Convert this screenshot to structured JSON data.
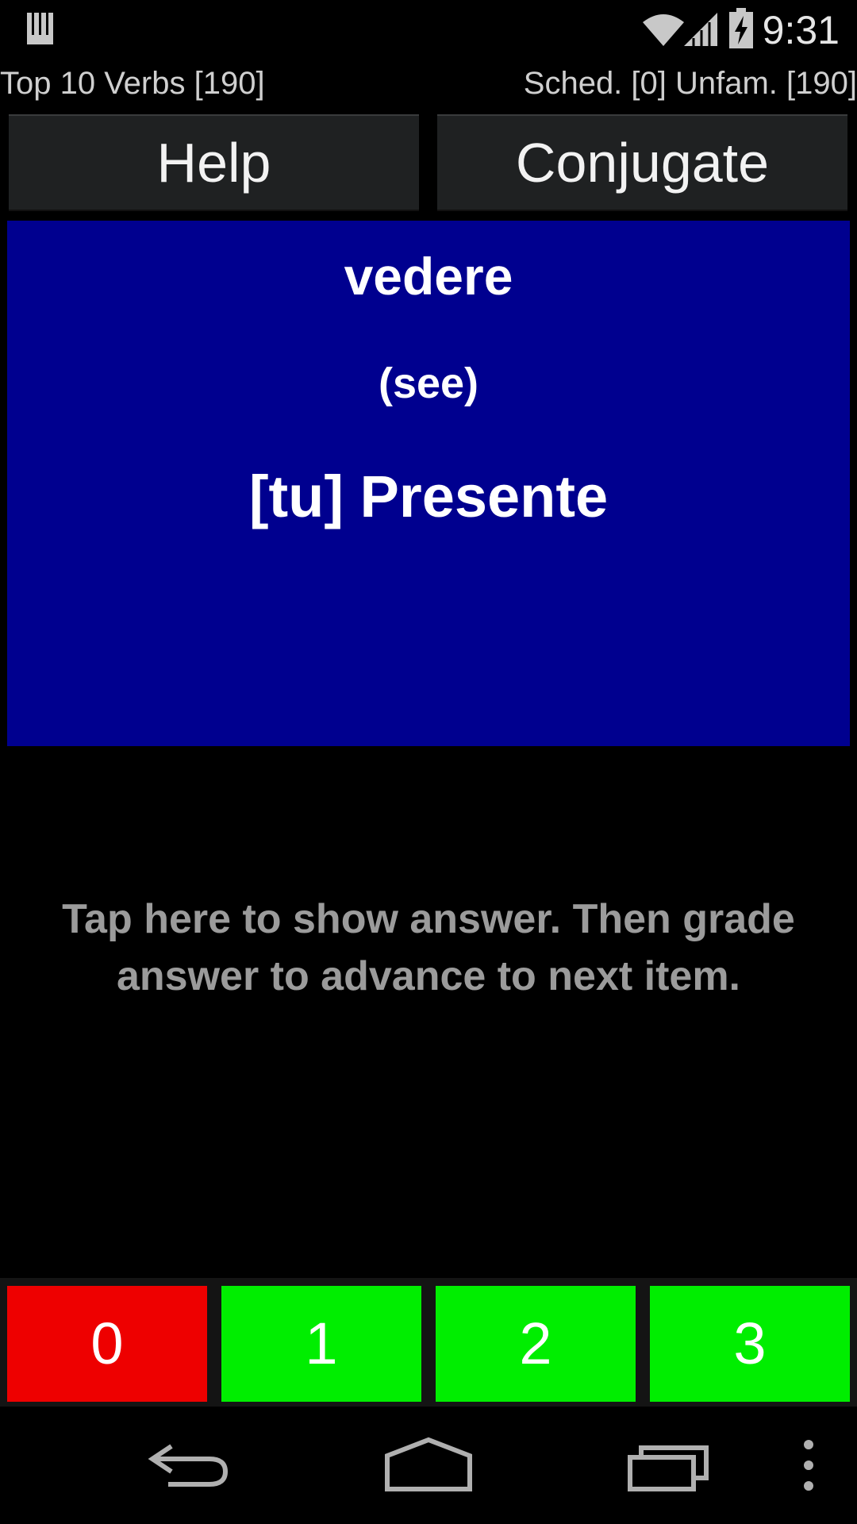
{
  "status_bar": {
    "time": "9:31",
    "icons": [
      "notification-icon",
      "wifi-icon",
      "signal-icon",
      "battery-charging-icon"
    ]
  },
  "info": {
    "deck": "Top 10 Verbs [190]",
    "stats": "Sched. [0] Unfam. [190]"
  },
  "buttons": {
    "help": "Help",
    "conjugate": "Conjugate"
  },
  "card": {
    "verb": "vedere",
    "meaning": "(see)",
    "prompt": "[tu] Presente",
    "background": "#00008f"
  },
  "answer_hint": "Tap here to show answer. Then grade answer to advance to next item.",
  "grades": [
    {
      "label": "0",
      "color": "#ee0000"
    },
    {
      "label": "1",
      "color": "#00ee00"
    },
    {
      "label": "2",
      "color": "#00ee00"
    },
    {
      "label": "3",
      "color": "#00ee00"
    }
  ],
  "nav": {
    "icons": [
      "back-icon",
      "home-icon",
      "recents-icon",
      "overflow-menu-icon"
    ]
  }
}
